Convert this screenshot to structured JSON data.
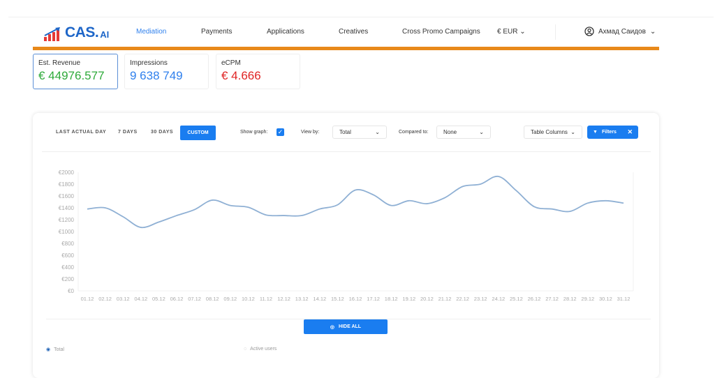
{
  "header": {
    "logo": "CAS.AI",
    "nav": [
      {
        "label": "Mediation",
        "active": true
      },
      {
        "label": "Payments"
      },
      {
        "label": "Applications"
      },
      {
        "label": "Creatives"
      },
      {
        "label": "Cross Promo Campaigns"
      }
    ],
    "currency": "€ EUR",
    "user": "Ахмад Саидов",
    "accent": "#e8891a"
  },
  "kpis": [
    {
      "label": "Est. Revenue",
      "value": "€ 44976.577",
      "color": "#2eaa3a"
    },
    {
      "label": "Impressions",
      "value": "9 638 749",
      "color": "#2f80ed"
    },
    {
      "label": "eCPM",
      "value": "€ 4.666",
      "color": "#e02424"
    }
  ],
  "controls": {
    "periods": [
      "LAST ACTUAL DAY",
      "7 DAYS",
      "30 DAYS",
      "CUSTOM"
    ],
    "active_period": "CUSTOM",
    "show_graph_label": "Show graph:",
    "show_graph": true,
    "view_by_label": "View by:",
    "view_by": "Total",
    "compared_to_label": "Compared to:",
    "compared_to": "None",
    "table_columns": "Table Columns",
    "filters": "Filters"
  },
  "chart_data": {
    "type": "line",
    "x": [
      "01.12",
      "02.12",
      "03.12",
      "04.12",
      "05.12",
      "06.12",
      "07.12",
      "08.12",
      "09.12",
      "10.12",
      "11.12",
      "12.12",
      "13.12",
      "14.12",
      "15.12",
      "16.12",
      "17.12",
      "18.12",
      "19.12",
      "20.12",
      "21.12",
      "22.12",
      "23.12",
      "24.12",
      "25.12",
      "26.12",
      "27.12",
      "28.12",
      "29.12",
      "30.12",
      "31.12"
    ],
    "series": [
      {
        "values": [
          1380,
          1400,
          1250,
          1070,
          1160,
          1270,
          1370,
          1530,
          1440,
          1410,
          1280,
          1270,
          1270,
          1380,
          1450,
          1700,
          1620,
          1440,
          1520,
          1470,
          1570,
          1760,
          1800,
          1930,
          1690,
          1420,
          1380,
          1340,
          1480,
          1520,
          1480
        ],
        "color": "#8fb0d4"
      }
    ],
    "yticks": [
      "€0",
      "€200",
      "€400",
      "€600",
      "€800",
      "€1000",
      "€1200",
      "€1400",
      "€1600",
      "€1800",
      "€2000"
    ],
    "ylim": [
      0,
      2000
    ],
    "grid": false
  },
  "footer": {
    "hide_all": "HIDE ALL",
    "legend": [
      {
        "label": "Total",
        "visible": true
      },
      {
        "label": "Active users",
        "visible": false
      }
    ]
  }
}
